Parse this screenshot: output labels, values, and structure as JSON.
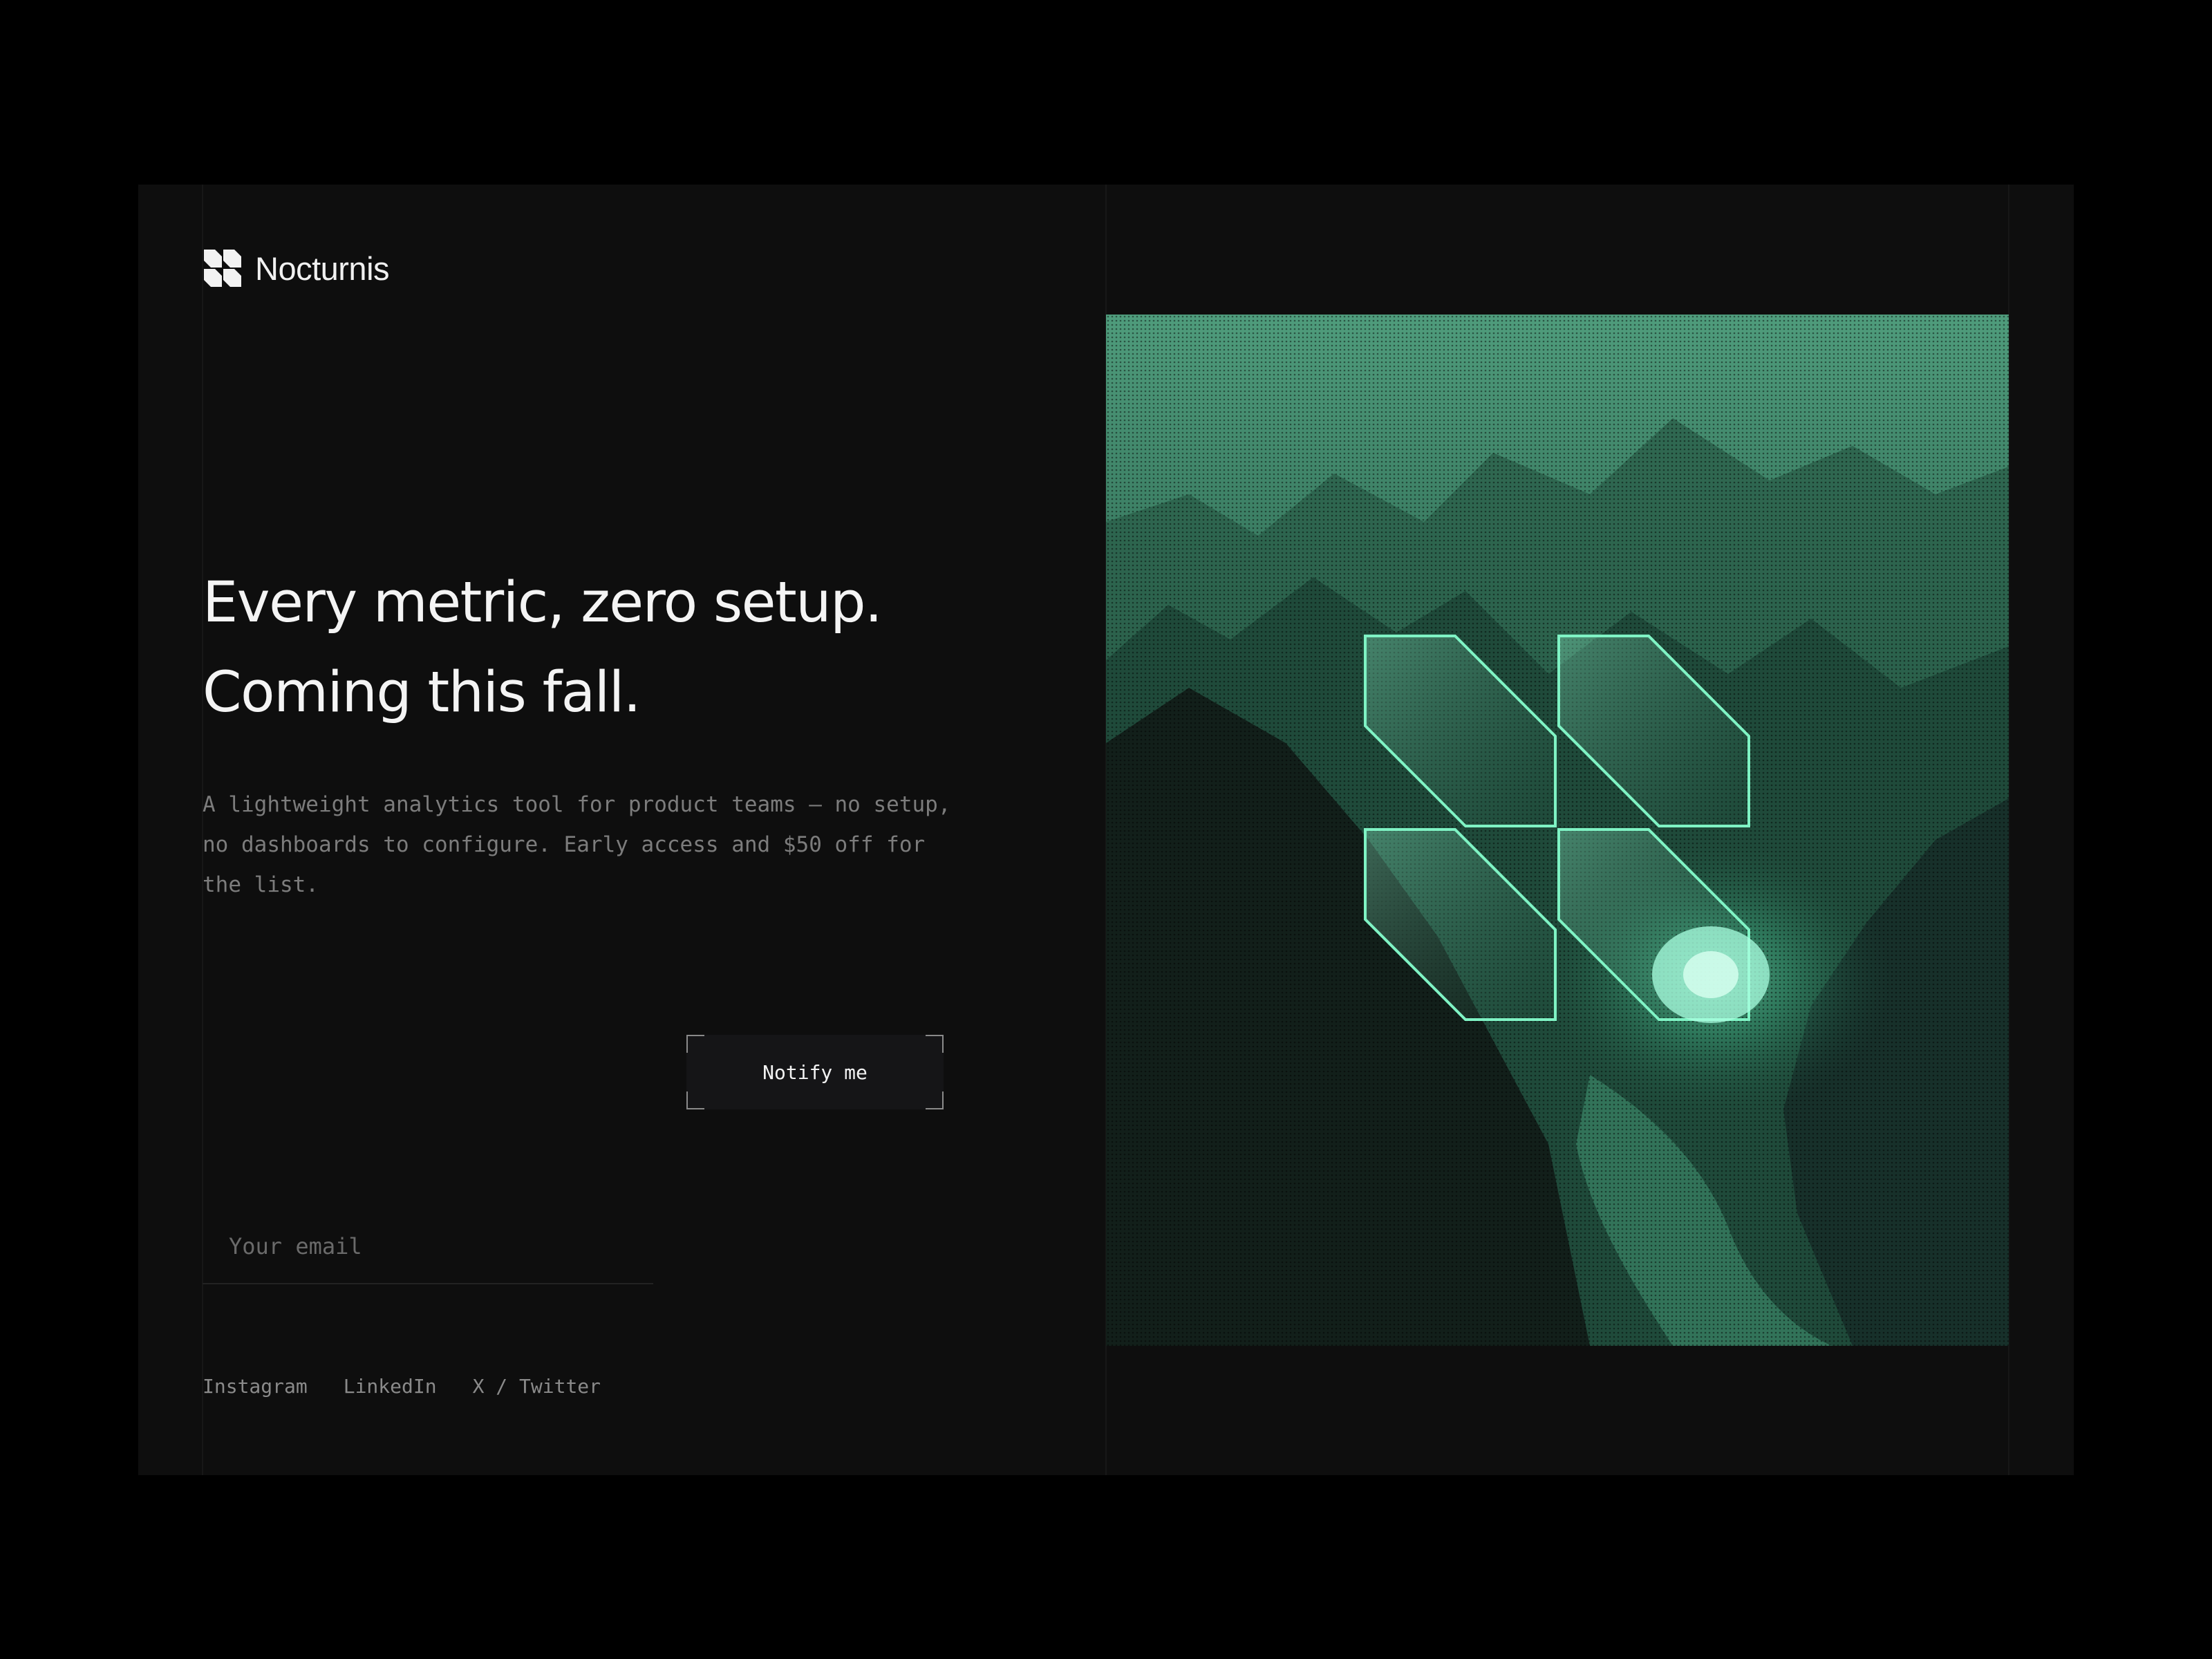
{
  "brand": {
    "name": "Nocturnis",
    "logo_icon": "four-diamond-logo-icon"
  },
  "hero": {
    "headline_line1": "Every metric, zero setup.",
    "headline_line2": "Coming this fall.",
    "description": "A lightweight analytics tool for product teams — no setup, no dashboards to configure. Early access and $50 off for the list."
  },
  "signup": {
    "email_placeholder": "Your email",
    "email_value": "",
    "button_label": "Notify me"
  },
  "socials": [
    {
      "label": "Instagram"
    },
    {
      "label": "LinkedIn"
    },
    {
      "label": "X / Twitter"
    }
  ],
  "colors": {
    "background": "#000000",
    "panel": "#0e0e0e",
    "accent": "#5ee6b0",
    "text_primary": "#f4f4f4",
    "text_muted": "#7c7c7c"
  }
}
